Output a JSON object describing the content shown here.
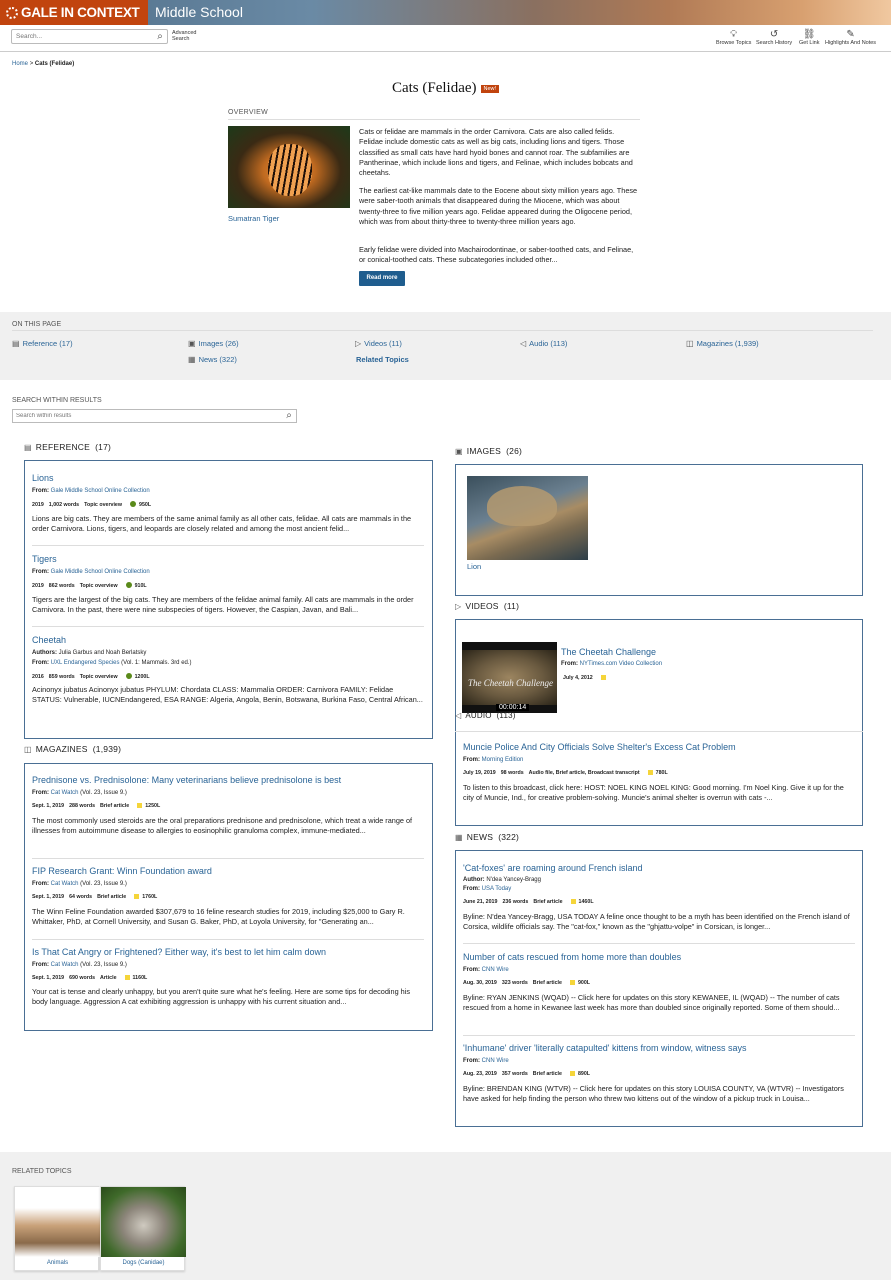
{
  "brand": "GALE IN CONTEXT",
  "product": "Middle School",
  "search": {
    "placeholder": "Search..."
  },
  "advanced": [
    "Advanced",
    "Search"
  ],
  "tools": [
    "Browse Topics",
    "Search History",
    "Get Link",
    "Highlights And Notes"
  ],
  "breadcrumb": {
    "home": "Home",
    "sep": ">",
    "current": "Cats (Felidae)"
  },
  "title": "Cats (Felidae)",
  "new_badge": "New!",
  "overview": {
    "label": "OVERVIEW",
    "image_caption": "Sumatran Tiger",
    "paragraphs": [
      "Cats or felidae are mammals in the order Carnivora. Cats are also called felids. Felidae include domestic cats as well as big cats, including lions and tigers. Those classified as small cats have hard hyoid bones and cannot roar. The subfamilies are Pantherinae, which include lions and tigers, and Felinae, which includes bobcats and cheetahs.",
      "The earliest cat-like mammals date to the Eocene about sixty million years ago. These were saber-tooth animals that disappeared during the Miocene, which was about twenty-three to five million years ago. Felidae appeared during the Oligocene period, which was from about thirty-three to twenty-three million years ago.",
      "Early felidae were divided into Machairodontinae, or saber-toothed cats, and Felinae, or conical-toothed cats. These subcategories included other..."
    ],
    "read_more": "Read more"
  },
  "on_this_page": {
    "label": "ON THIS PAGE",
    "links": [
      "Reference (17)",
      "Images (26)",
      "Videos (11)",
      "Audio (113)",
      "Magazines (1,939)",
      "News (322)",
      "Related Topics"
    ]
  },
  "search_within": {
    "label": "SEARCH WITHIN RESULTS",
    "placeholder": "Search within results"
  },
  "reference": {
    "label": "REFERENCE",
    "count": "(17)",
    "items": [
      {
        "title": "Lions",
        "from_label": "From:",
        "from": "Gale Middle School Online Collection",
        "meta": [
          "2019",
          "1,002 words",
          "Topic overview",
          "950L"
        ],
        "desc": "Lions are big cats. They are members of the same animal family as all other cats, felidae. All cats are mammals in the order Carnivora. Lions, tigers, and leopards are closely related and among the most ancient felid..."
      },
      {
        "title": "Tigers",
        "from_label": "From:",
        "from": "Gale Middle School Online Collection",
        "meta": [
          "2019",
          "862 words",
          "Topic overview",
          "910L"
        ],
        "desc": "Tigers are the largest of the big cats. They are members of the felidae animal family. All cats are mammals in the order Carnivora. In the past, there were nine subspecies of tigers. However, the Caspian, Javan, and Bali..."
      },
      {
        "title": "Cheetah",
        "authors_label": "Authors:",
        "authors": "Julia Garbus and Noah Berlatsky",
        "from_label": "From:",
        "from": "UXL Endangered Species",
        "from_extra": "(Vol. 1: Mammals. 3rd ed.)",
        "meta": [
          "2016",
          "859 words",
          "Topic overview",
          "1200L"
        ],
        "desc": "Acinonyx jubatus Acinonyx jubatus PHYLUM: Chordata CLASS: Mammalia ORDER: Carnivora FAMILY: Felidae STATUS: Vulnerable, IUCNEndangered, ESA RANGE: Algeria, Angola, Benin, Botswana, Burkina Faso, Central African..."
      }
    ]
  },
  "magazines": {
    "label": "MAGAZINES",
    "count": "(1,939)",
    "items": [
      {
        "title": "Prednisone vs. Prednisolone: Many veterinarians believe prednisolone is best",
        "from_label": "From:",
        "from": "Cat Watch",
        "from_extra": "(Vol. 23, Issue 9.)",
        "meta": [
          "Sept. 1, 2019",
          "288 words",
          "Brief article",
          "1250L"
        ],
        "desc": "The most commonly used steroids are the oral preparations prednisone and prednisolone, which treat a wide range of illnesses from autoimmune disease to allergies to eosinophilic granuloma complex, immune-mediated..."
      },
      {
        "title": "FIP Research Grant: Winn Foundation award",
        "from_label": "From:",
        "from": "Cat Watch",
        "from_extra": "(Vol. 23, Issue 9.)",
        "meta": [
          "Sept. 1, 2019",
          "64 words",
          "Brief article",
          "1760L"
        ],
        "desc": "The Winn Feline Foundation awarded $307,679 to 16 feline research studies for 2019, including $25,000 to Gary R. Whittaker, PhD, at Cornell University, and Susan G. Baker, PhD, at Loyola University, for \"Generating an..."
      },
      {
        "title": "Is That Cat Angry or Frightened? Either way, it's best to let him calm down",
        "from_label": "From:",
        "from": "Cat Watch",
        "from_extra": "(Vol. 23, Issue 9.)",
        "meta": [
          "Sept. 1, 2019",
          "690 words",
          "Article",
          "1160L"
        ],
        "desc": "Your cat is tense and clearly unhappy, but you aren't quite sure what he's feeling. Here are some tips for decoding his body language. Aggression A cat exhibiting aggression is unhappy with his current situation and..."
      }
    ]
  },
  "images": {
    "label": "IMAGES",
    "count": "(26)",
    "items": [
      {
        "caption": "Lion"
      }
    ]
  },
  "videos": {
    "label": "VIDEOS",
    "count": "(11)",
    "items": [
      {
        "title": "The Cheetah Challenge",
        "from_label": "From:",
        "from": "NYTimes.com Video Collection",
        "date": "July 4, 2012",
        "thumb_text": "The Cheetah Challenge",
        "duration": "00:00:14"
      }
    ]
  },
  "audio": {
    "label": "AUDIO",
    "count": "(113)",
    "items": [
      {
        "title": "Muncie Police And City Officials Solve Shelter's Excess Cat Problem",
        "from_label": "From:",
        "from": "Morning Edition",
        "meta": [
          "July 19, 2019",
          "98 words",
          "Audio file, Brief article, Broadcast transcript",
          "780L"
        ],
        "desc": "To listen to this broadcast, click here: HOST: NOEL KING NOEL KING: Good morning. I'm Noel King. Give it up for the city of Muncie, Ind., for creative problem-solving. Muncie's animal shelter is overrun with cats -..."
      }
    ]
  },
  "news": {
    "label": "NEWS",
    "count": "(322)",
    "items": [
      {
        "title": "'Cat-foxes' are roaming around French island",
        "author_label": "Author:",
        "author": "N'dea Yancey-Bragg",
        "from_label": "From:",
        "from": "USA Today",
        "meta": [
          "June 21, 2019",
          "236 words",
          "Brief article",
          "1460L"
        ],
        "desc": "Byline: N'dea Yancey-Bragg, USA TODAY A feline once thought to be a myth has been identified on the French island of Corsica, wildlife officials say. The \"cat-fox,\" known as the \"ghjattu-volpe\" in Corsican, is longer..."
      },
      {
        "title": "Number of cats rescued from home more than doubles",
        "from_label": "From:",
        "from": "CNN Wire",
        "meta": [
          "Aug. 30, 2019",
          "323 words",
          "Brief article",
          "900L"
        ],
        "desc": "Byline: RYAN JENKINS (WQAD) -- Click here for updates on this story KEWANEE, IL (WQAD) -- The number of cats rescued from a home in Kewanee last week has more than doubled since originally reported. Some of them should..."
      },
      {
        "title": "'Inhumane' driver 'literally catapulted' kittens from window, witness says",
        "from_label": "From:",
        "from": "CNN Wire",
        "meta": [
          "Aug. 23, 2019",
          "357 words",
          "Brief article",
          "890L"
        ],
        "desc": "Byline: BRENDAN KING (WTVR) -- Click here for updates on this story LOUISA COUNTY, VA (WTVR) -- Investigators have asked for help finding the person who threw two kittens out of the window of a pickup truck in Louisa..."
      }
    ]
  },
  "related": {
    "label": "RELATED TOPICS",
    "items": [
      "Animals",
      "Dogs (Canidae)"
    ]
  }
}
